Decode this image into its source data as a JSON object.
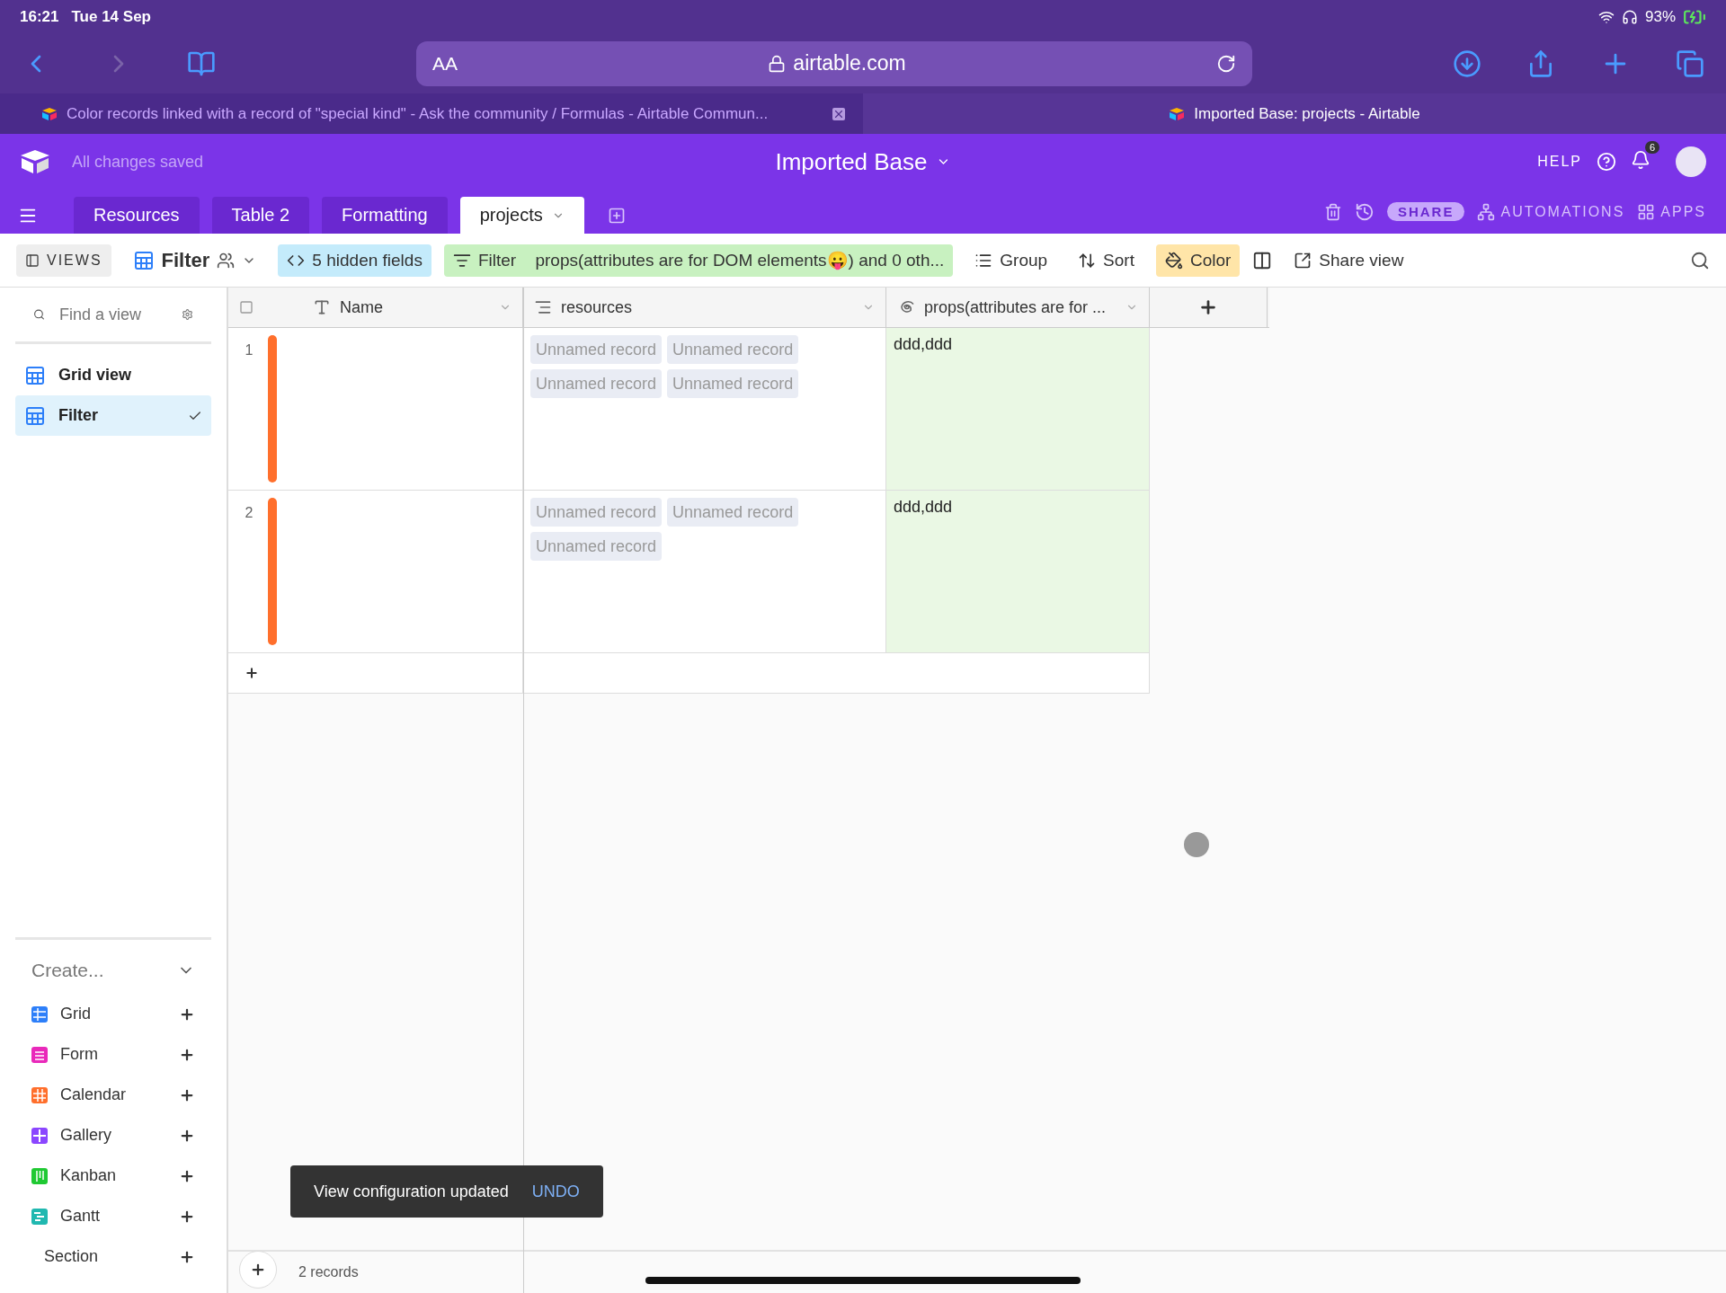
{
  "status_bar": {
    "time": "16:21",
    "date": "Tue 14 Sep",
    "battery": "93%"
  },
  "browser": {
    "reader": "AA",
    "address": "airtable.com",
    "tabs": [
      {
        "title": "Color records linked with a record of \"special kind\" - Ask the community / Formulas - Airtable Commun...",
        "selected": false
      },
      {
        "title": "Imported Base: projects - Airtable",
        "selected": true
      }
    ]
  },
  "app": {
    "save_status": "All changes saved",
    "base_name": "Imported Base",
    "help": "HELP",
    "notifications": "6",
    "table_tabs": [
      {
        "label": "Resources",
        "selected": false
      },
      {
        "label": "Table 2",
        "selected": false
      },
      {
        "label": "Formatting",
        "selected": false
      },
      {
        "label": "projects",
        "selected": true
      }
    ],
    "share": "SHARE",
    "automations": "AUTOMATIONS",
    "apps": "APPS"
  },
  "view_bar": {
    "views": "VIEWS",
    "current_view": "Filter",
    "hidden_fields": "5 hidden fields",
    "filter_label": "Filter",
    "filter_text": "props(attributes are for DOM elements😛) and 0 oth...",
    "group": "Group",
    "sort": "Sort",
    "color": {
      "label": "Color",
      "active": true
    },
    "share_view": "Share view"
  },
  "sidebar": {
    "search_placeholder": "Find a view",
    "views": [
      {
        "name": "Grid view",
        "selected": false
      },
      {
        "name": "Filter",
        "selected": true
      }
    ],
    "create": "Create...",
    "create_items": [
      {
        "kind": "grid",
        "label": "Grid",
        "color": "#2d7ff9"
      },
      {
        "kind": "form",
        "label": "Form",
        "color": "#e929ba"
      },
      {
        "kind": "calendar",
        "label": "Calendar",
        "color": "#ff6f2c"
      },
      {
        "kind": "gallery",
        "label": "Gallery",
        "color": "#8b46ff"
      },
      {
        "kind": "kanban",
        "label": "Kanban",
        "color": "#20c933"
      },
      {
        "kind": "gantt",
        "label": "Gantt",
        "color": "#20b8b0"
      },
      {
        "kind": "section",
        "label": "Section"
      }
    ]
  },
  "grid": {
    "select_all": {
      "checked": false
    },
    "columns": [
      {
        "kind": "text",
        "name": "Name"
      },
      {
        "kind": "link",
        "name": "resources"
      },
      {
        "kind": "formula",
        "name": "props(attributes are for ..."
      }
    ],
    "rows": [
      {
        "number": "1",
        "color": "#ff6f2c",
        "resources": [
          "Unnamed record",
          "Unnamed record",
          "Unnamed record",
          "Unnamed record"
        ],
        "props": "ddd,ddd"
      },
      {
        "number": "2",
        "color": "#ff6f2c",
        "resources": [
          "Unnamed record",
          "Unnamed record",
          "Unnamed record"
        ],
        "props": "ddd,ddd"
      }
    ],
    "footer": "2 records"
  },
  "toast": {
    "message": "View configuration updated",
    "action": "UNDO"
  }
}
